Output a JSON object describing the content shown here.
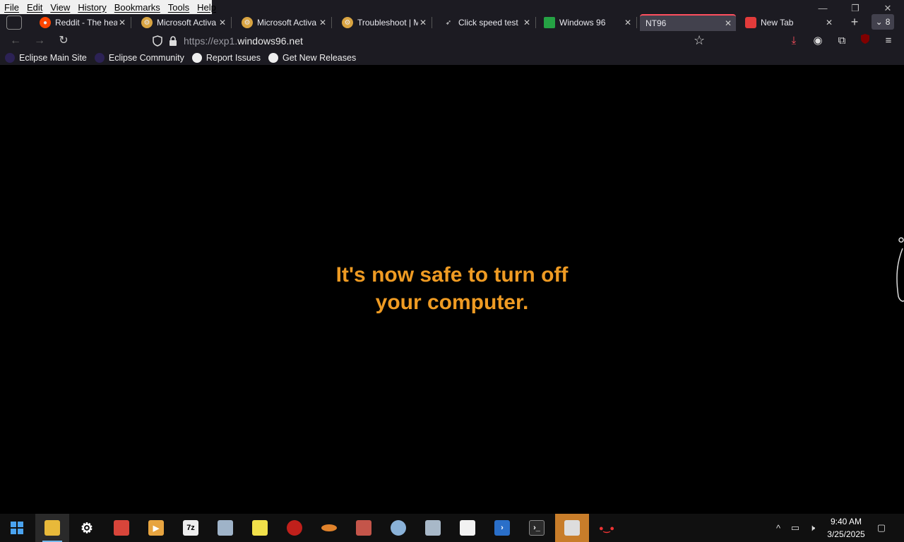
{
  "menu": [
    "File",
    "Edit",
    "View",
    "History",
    "Bookmarks",
    "Tools",
    "Help"
  ],
  "tabs": [
    {
      "title": "Reddit - The hea",
      "icon": "reddit-icon",
      "color": "#ff4500"
    },
    {
      "title": "Microsoft Activa",
      "icon": "gear-icon",
      "color": "#d9a441"
    },
    {
      "title": "Microsoft Activa",
      "icon": "gear-icon",
      "color": "#d9a441"
    },
    {
      "title": "Troubleshoot | M",
      "icon": "gear-icon",
      "color": "#d9a441"
    },
    {
      "title": "Click speed test",
      "icon": "cursor-icon",
      "color": "#dddddd"
    },
    {
      "title": "Windows 96",
      "icon": "windows96-icon",
      "color": "#25a244"
    },
    {
      "title": "NT96",
      "icon": "",
      "color": ""
    },
    {
      "title": "New Tab",
      "icon": "firefox-icon",
      "color": "#e23b3b"
    }
  ],
  "tab_count": "8",
  "url": {
    "prefix": "https://exp1.",
    "domain": "windows96.net"
  },
  "bookmarks": [
    {
      "label": "Eclipse Main Site",
      "icon": "eclipse-icon"
    },
    {
      "label": "Eclipse Community",
      "icon": "eclipse-icon"
    },
    {
      "label": "Report Issues",
      "icon": "github-icon"
    },
    {
      "label": "Get New Releases",
      "icon": "github-icon"
    }
  ],
  "message": {
    "line1": "It's now safe to turn off",
    "line2": "your computer."
  },
  "accent_color": "#ef9b23",
  "clock": {
    "time": "9:40 AM",
    "date": "3/25/2025"
  },
  "taskbar_icons": [
    "start-icon",
    "file-explorer-icon",
    "settings-icon",
    "app-red-icon",
    "media-player-icon",
    "7zip-icon",
    "calculator-icon",
    "spongebob-icon",
    "red-ball-icon",
    "fish-icon",
    "app-crab-icon",
    "app-disc-icon",
    "app-photo-icon",
    "notepad-icon",
    "powershell-icon",
    "terminal-icon",
    "app-calendar-icon",
    "app-char-icon"
  ]
}
